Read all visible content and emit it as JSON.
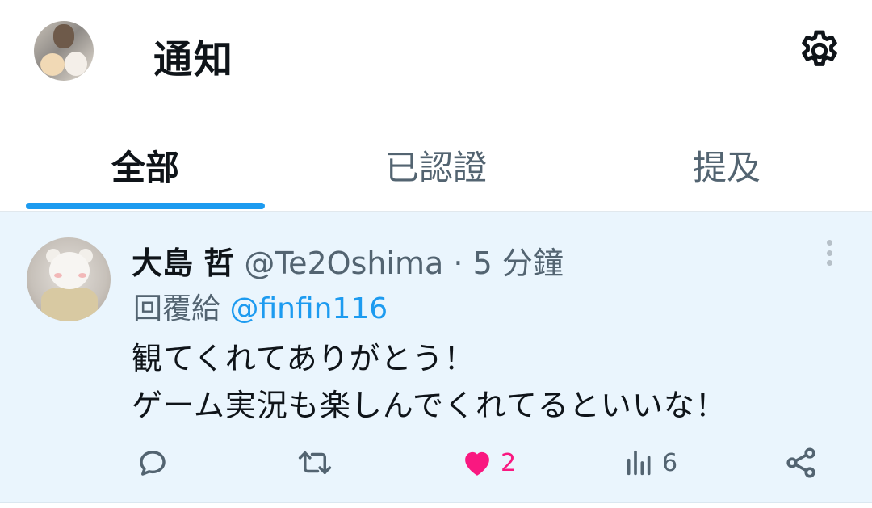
{
  "header": {
    "title": "通知",
    "avatar_icon": "profile-avatar",
    "settings_icon": "gear-icon"
  },
  "tabs": [
    {
      "label": "全部",
      "active": true
    },
    {
      "label": "已認證",
      "active": false
    },
    {
      "label": "提及",
      "active": false
    }
  ],
  "notification": {
    "display_name": "大島 哲",
    "handle": "@Te2Oshima",
    "separator": "·",
    "time": "5 分鐘",
    "reply_prefix": "回覆給 ",
    "reply_to": "@finfin116",
    "text_lines": [
      "観てくれてありがとう！",
      "ゲーム実況も楽しんでくれてるといいな！"
    ],
    "actions": {
      "reply_count": "",
      "retweet_count": "",
      "like_count": "2",
      "view_count": "6"
    }
  },
  "colors": {
    "accent": "#1d9bf0",
    "like": "#f91880",
    "highlight_bg": "#eaf5fd",
    "secondary_text": "#536471"
  }
}
